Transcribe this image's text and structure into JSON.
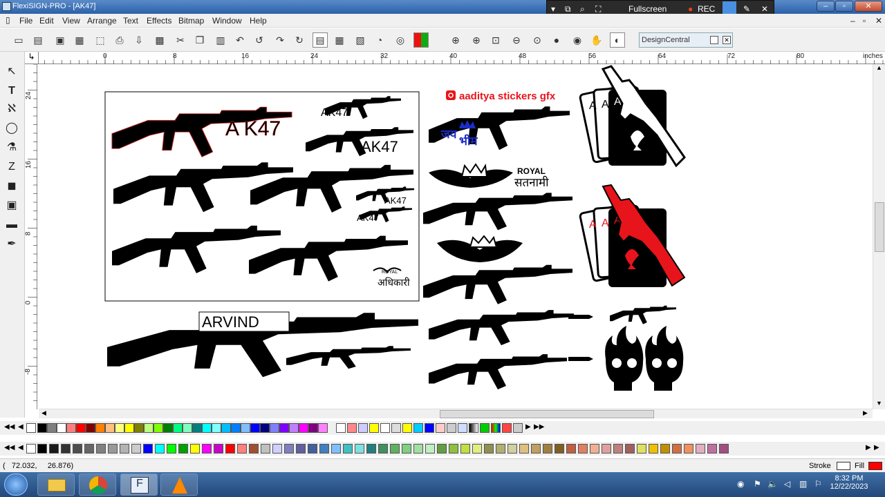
{
  "window": {
    "title": "FlexiSIGN-PRO - [AK47]"
  },
  "recorder": {
    "fullscreen_label": "Fullscreen",
    "rec_label": "REC"
  },
  "menu": [
    "File",
    "Edit",
    "View",
    "Arrange",
    "Text",
    "Effects",
    "Bitmap",
    "Window",
    "Help"
  ],
  "toolbar": {
    "design_central": "DesignCentral"
  },
  "ruler": {
    "h_labels": [
      "0",
      "8",
      "16",
      "24",
      "32",
      "40",
      "48",
      "56",
      "64",
      "72",
      "80"
    ],
    "units": "inches",
    "v_labels": [
      "24",
      "16",
      "8",
      "0",
      "-8"
    ]
  },
  "canvas_text": {
    "ak47_a": "A K47",
    "ak47_b": "AK47",
    "ak47_c": "AK47",
    "ak47_d": "AK47",
    "ak47_e": "AK47",
    "aaditya": "aaditya stickers gfx",
    "jay": "जय",
    "bhim": "भीम",
    "royal": "ROYAL",
    "satnami": "सतनामी",
    "arvind": "ARVIND",
    "royal_small": "ROYAL",
    "adhikari": "अधिकारी"
  },
  "status": {
    "coords": "(   72.032,     26.876)",
    "stroke_label": "Stroke",
    "fill_label": "Fill",
    "fill_color": "#ff0000"
  },
  "taskbar": {
    "time": "8:32 PM",
    "date": "12/22/2023"
  },
  "colors": {
    "accent_red": "#e8141b",
    "accent_blue": "#1a2dc8",
    "titlebar": "#2b61a8"
  },
  "palette_top": [
    "#000000",
    "#7f7f7f",
    "#ffffff",
    "#ff7f7f",
    "#ff0000",
    "#7f0000",
    "#ff7f00",
    "#ffbf7f",
    "#ffff7f",
    "#ffff00",
    "#7f7f00",
    "#bfff7f",
    "#7fff00",
    "#007f00",
    "#00ff7f",
    "#7fffbf",
    "#007f7f",
    "#00ffff",
    "#7fffff",
    "#00bfff",
    "#007fff",
    "#7fbfff",
    "#0000ff",
    "#00007f",
    "#7f7fff",
    "#7f00ff",
    "#bf7fff",
    "#ff00ff",
    "#7f007f",
    "#ff7fff",
    "#ff007f",
    "#ff7fbf"
  ],
  "palette_bottom": [
    "#000000",
    "#1a1a1a",
    "#333333",
    "#4d4d4d",
    "#666666",
    "#808080",
    "#999999",
    "#b3b3b3",
    "#cccccc",
    "#0000ff",
    "#00ffff",
    "#00ff00",
    "#00a000",
    "#ffff00",
    "#ff00ff",
    "#cc00cc",
    "#ff0000",
    "#ff8080",
    "#a05030",
    "#c0c0c0",
    "#d0d0ff",
    "#8080c0",
    "#6060a0",
    "#4060a0",
    "#4080c0",
    "#80c0ff",
    "#40c0c0",
    "#80e0e0",
    "#208080",
    "#409060",
    "#60b060",
    "#80d080",
    "#a0e0a0",
    "#c0f0c0",
    "#60a040",
    "#90c040",
    "#c0e040",
    "#e0f080",
    "#909050",
    "#b0b070",
    "#d0d0a0",
    "#e0c080",
    "#c0a060",
    "#a08040",
    "#806020",
    "#c06040",
    "#e08060",
    "#f0b090",
    "#e0a0a0",
    "#c08080",
    "#a06060",
    "#e0e060",
    "#f0c000",
    "#c09000",
    "#d07040",
    "#f09060",
    "#e0b0c0",
    "#c070a0",
    "#a05080"
  ],
  "taskbar_tray": [
    "shield",
    "flag",
    "speaker",
    "network",
    "volume"
  ]
}
